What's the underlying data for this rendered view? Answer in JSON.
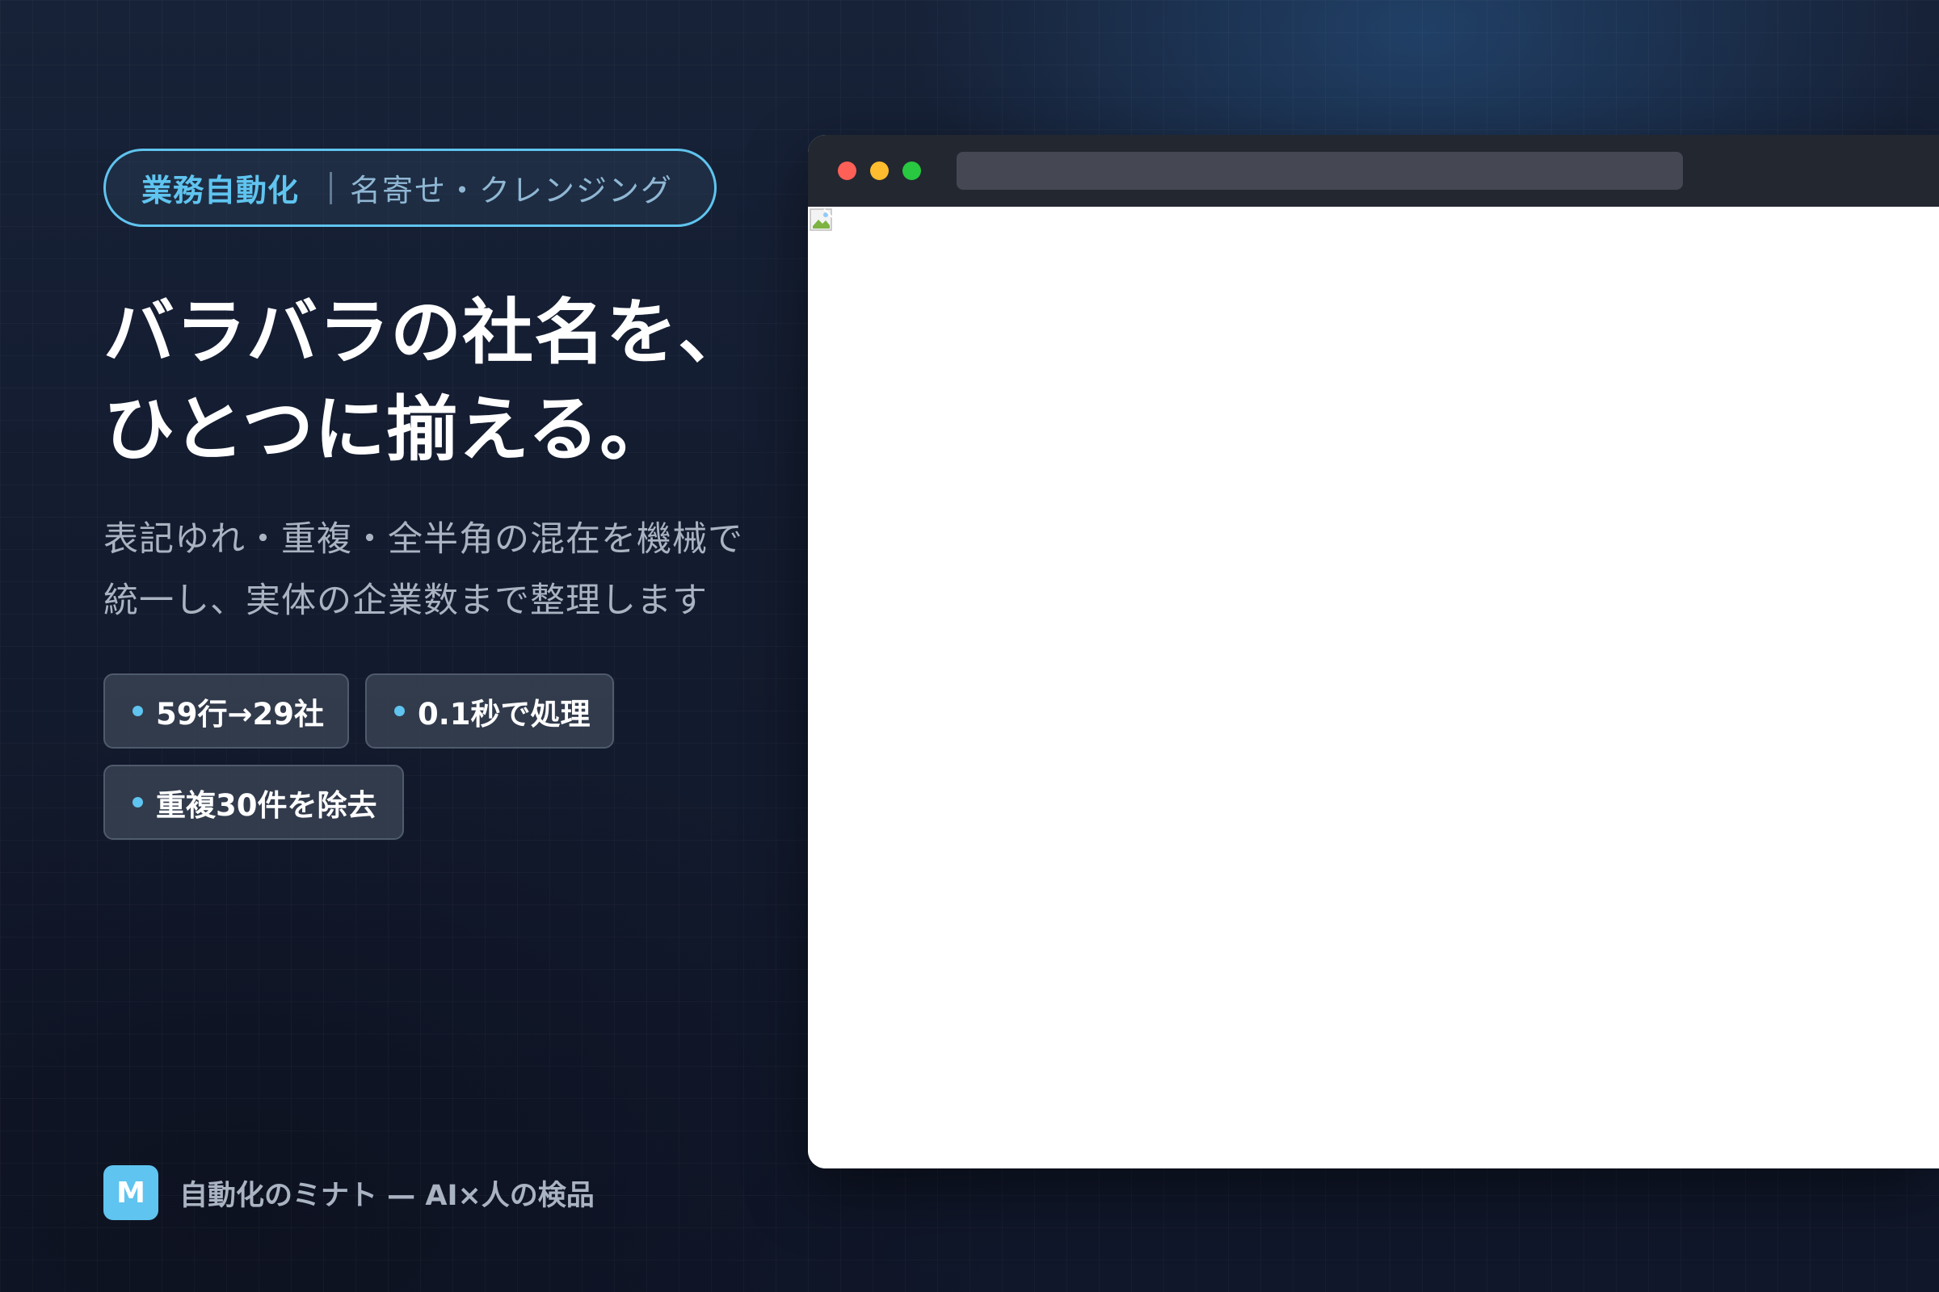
{
  "tag": {
    "primary": "業務自動化",
    "secondary": "名寄せ・クレンジング"
  },
  "headline": {
    "line1": "バラバラの社名を、",
    "line2": "ひとつに揃える。"
  },
  "subtext": {
    "line1": "表記ゆれ・重複・全半角の混在を機械で",
    "line2": "統一し、実体の企業数まで整理します"
  },
  "stats": [
    {
      "label": "59行→29社"
    },
    {
      "label": "0.1秒で処理"
    },
    {
      "label": "重複30件を除去"
    }
  ],
  "brand": {
    "logo_letter": "M",
    "text": "自動化のミナト — AI×人の検品"
  },
  "browser": {
    "screenshot_alt": ""
  },
  "colors": {
    "accent": "#5fc4ef",
    "background": "#131b2e",
    "chip_background": "#384252",
    "browser_bar": "#232730",
    "traffic_red": "#fe5f57",
    "traffic_yellow": "#febc2e",
    "traffic_green": "#28c840"
  },
  "icons": {
    "chip_marker": "dot-icon",
    "broken_image": "broken-image-icon"
  }
}
